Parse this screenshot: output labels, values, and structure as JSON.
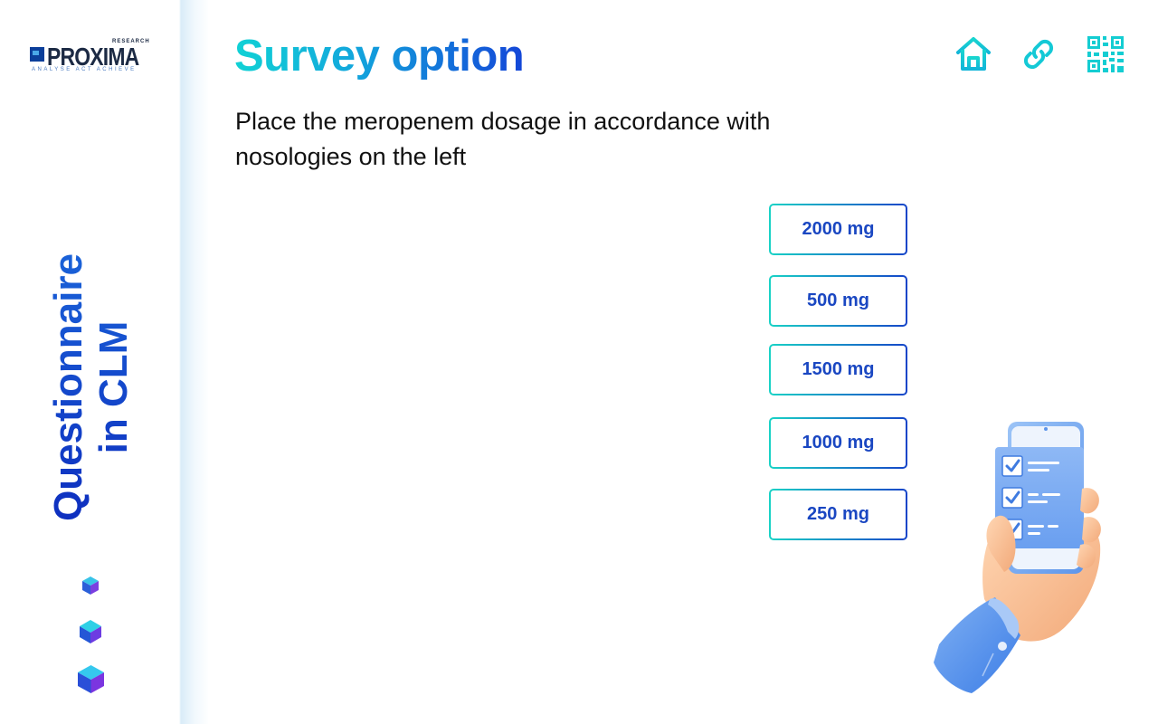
{
  "brand": {
    "name": "PROXIMA",
    "superscript": "RESEARCH",
    "tagline": "ANALYSE  ACT  ACHIEVE"
  },
  "sidebar": {
    "title_line1": "Questionnaire",
    "title_line2": "in CLM"
  },
  "header": {
    "title": "Survey option",
    "icons": [
      "home-icon",
      "link-icon",
      "qr-code-icon"
    ]
  },
  "question": {
    "text": "Place the meropenem dosage in accordance with nosologies on the left"
  },
  "options": [
    {
      "label": "2000 mg"
    },
    {
      "label": "500 mg"
    },
    {
      "label": "1500 mg"
    },
    {
      "label": "1000 mg"
    },
    {
      "label": "250 mg"
    }
  ],
  "colors": {
    "accent_cyan": "#12d0d3",
    "accent_blue": "#1446d8",
    "sidebar_title": "#1235c9",
    "option_text": "#1a47c2"
  }
}
